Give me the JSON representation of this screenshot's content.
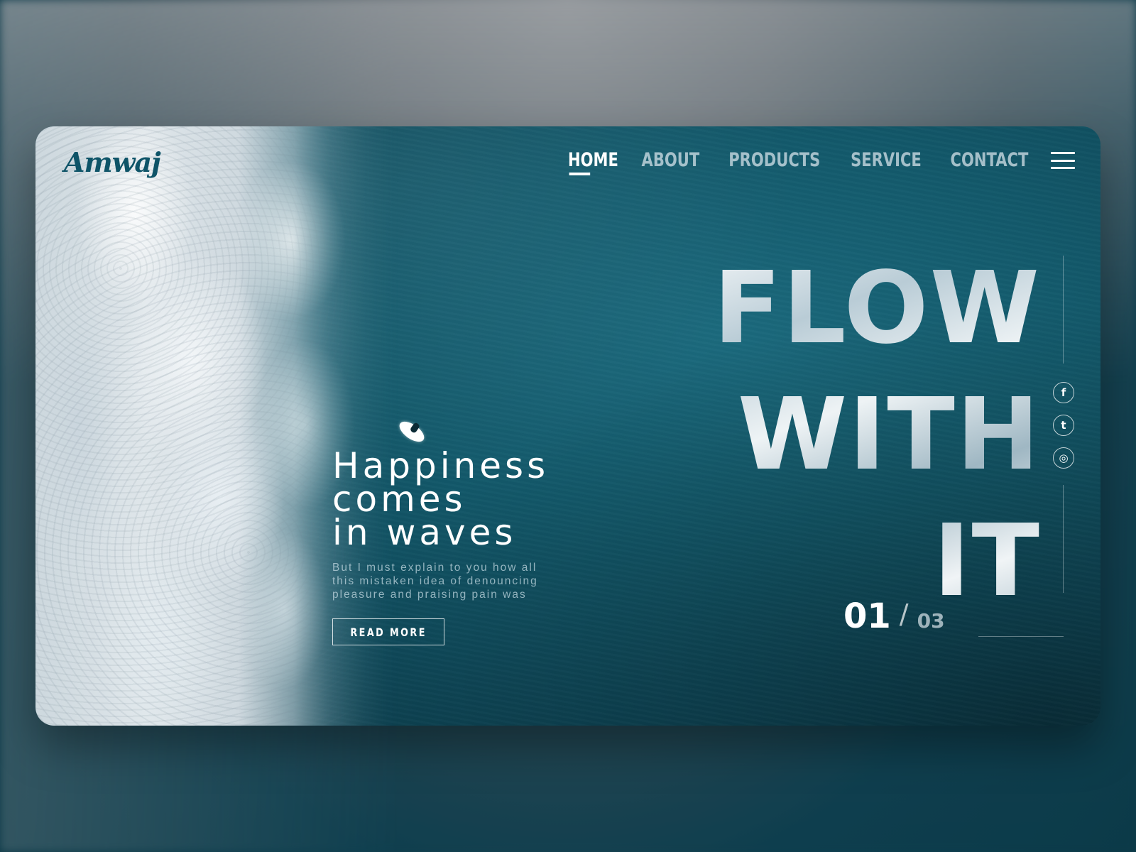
{
  "brand": {
    "logo": "Amwaj"
  },
  "nav": {
    "items": [
      "HOME",
      "ABOUT",
      "PRODUCTS",
      "SERVICE",
      "CONTACT"
    ],
    "active": "HOME",
    "menu_icon": "hamburger-icon"
  },
  "hero": {
    "headline": [
      "FLOW",
      "WITH",
      "IT"
    ],
    "tagline": [
      "Happiness",
      "comes",
      "in waves"
    ],
    "description": [
      "But I must explain to you how all",
      "this mistaken idea of denouncing",
      "pleasure and praising pain was"
    ],
    "cta_label": "READ MORE"
  },
  "social": [
    {
      "name": "facebook-icon",
      "glyph": "f"
    },
    {
      "name": "twitter-icon",
      "glyph": "t"
    },
    {
      "name": "instagram-icon",
      "glyph": "◎"
    }
  ],
  "pager": {
    "current": "01",
    "separator": "/",
    "total": "03"
  },
  "colors": {
    "ocean": "#135a6c",
    "deep": "#0a3644",
    "logo": "#0e5468",
    "text": "#ffffff"
  }
}
